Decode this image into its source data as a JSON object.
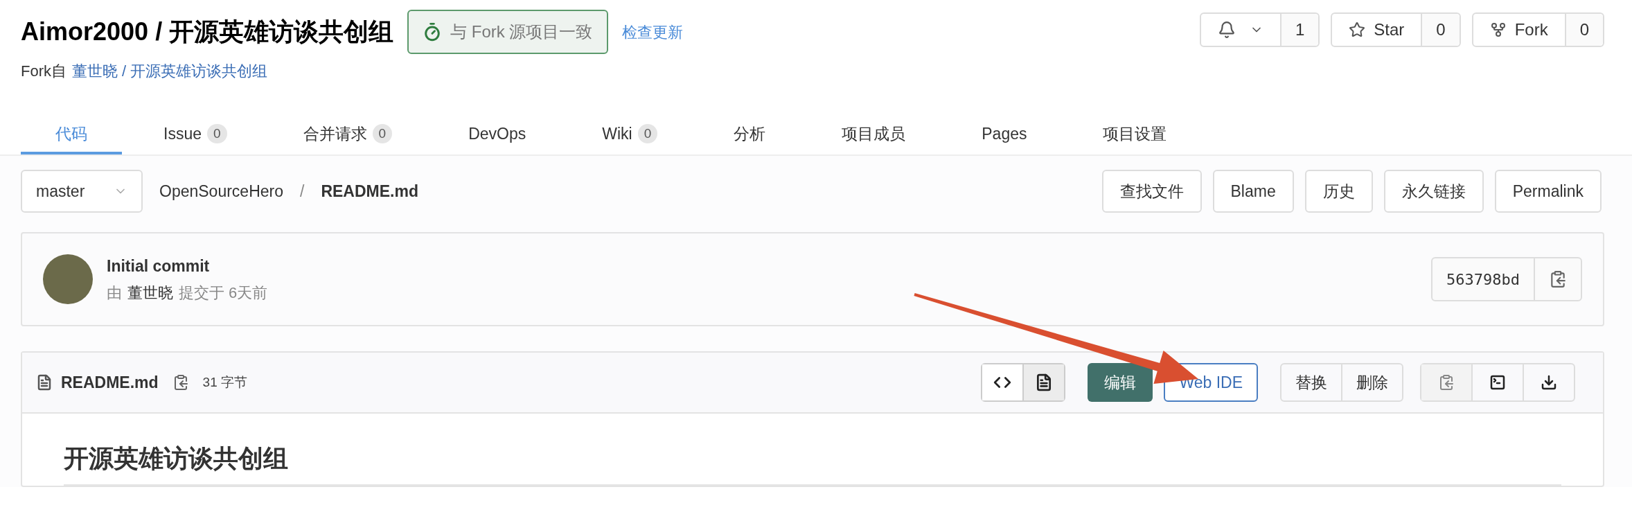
{
  "project": {
    "owner": "Aimor2000",
    "separator": "/",
    "name": "开源英雄访谈共创组",
    "sync_badge": "与 Fork 源项目一致",
    "check_updates": "检查更新",
    "fork_prefix": "Fork自",
    "fork_source": "董世晓 / 开源英雄访谈共创组"
  },
  "actions": [
    {
      "kind": "notify",
      "count": "1"
    },
    {
      "kind": "star",
      "label": "Star",
      "count": "0"
    },
    {
      "kind": "fork",
      "label": "Fork",
      "count": "0"
    }
  ],
  "tabs": [
    {
      "label": "代码",
      "selected": true
    },
    {
      "label": "Issue",
      "count": "0",
      "selected": false
    },
    {
      "label": "合并请求",
      "count": "0",
      "selected": false
    },
    {
      "label": "DevOps",
      "selected": false
    },
    {
      "label": "Wiki",
      "count": "0",
      "selected": false
    },
    {
      "label": "分析",
      "selected": false
    },
    {
      "label": "项目成员",
      "selected": false
    },
    {
      "label": "Pages",
      "selected": false
    },
    {
      "label": "项目设置",
      "selected": false
    }
  ],
  "branch": "master",
  "breadcrumb": {
    "repo": "OpenSourceHero",
    "separator": "/",
    "file": "README.md"
  },
  "file_actions": [
    "查找文件",
    "Blame",
    "历史",
    "永久链接",
    "Permalink"
  ],
  "commit": {
    "title": "Initial commit",
    "by": "由",
    "author": "董世晓",
    "meta": "提交于 6天前",
    "sha": "563798bd"
  },
  "file": {
    "name": "README.md",
    "size": "31 字节",
    "view_modes": [
      {
        "kind": "source",
        "selected": false
      },
      {
        "kind": "rendered",
        "selected": true
      }
    ],
    "edit": "编辑",
    "web_ide": "Web IDE",
    "replace": "替换",
    "delete": "删除"
  },
  "readme": {
    "heading": "开源英雄访谈共创组"
  }
}
